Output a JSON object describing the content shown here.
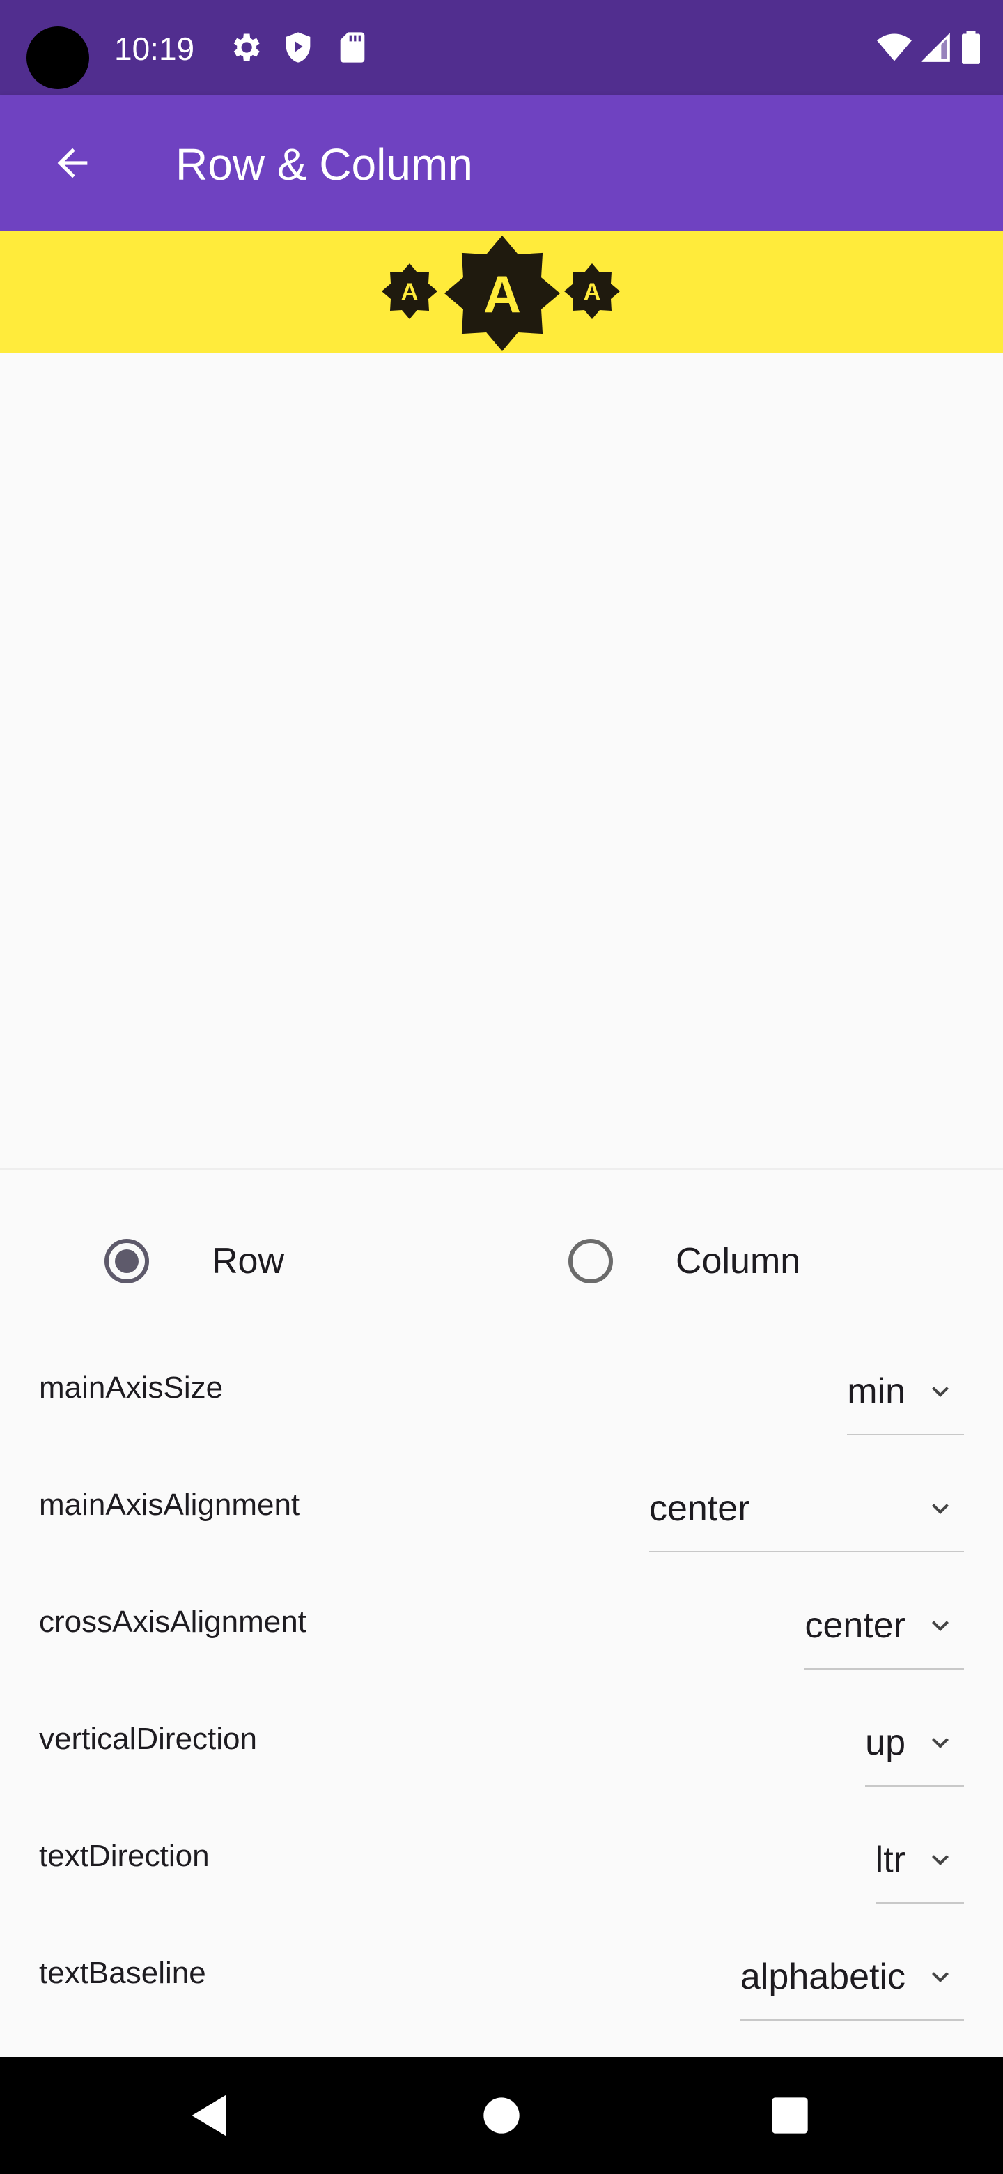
{
  "status_bar": {
    "time": "10:19",
    "icons_left": [
      "gear-icon",
      "shield-play-icon",
      "sd-card-icon"
    ],
    "icons_right": [
      "wifi-icon",
      "signal-icon",
      "battery-icon"
    ]
  },
  "app_bar": {
    "title": "Row & Column",
    "back_icon": "arrow-back-icon",
    "color": "#6f42c1"
  },
  "preview": {
    "background": "#ffeb3b",
    "items": [
      {
        "letter": "A",
        "size": "small"
      },
      {
        "letter": "A",
        "size": "large"
      },
      {
        "letter": "A",
        "size": "small"
      }
    ]
  },
  "layout_type": {
    "options": [
      {
        "label": "Row",
        "selected": true
      },
      {
        "label": "Column",
        "selected": false
      }
    ]
  },
  "settings": [
    {
      "label": "mainAxisSize",
      "value": "min"
    },
    {
      "label": "mainAxisAlignment",
      "value": "center"
    },
    {
      "label": "crossAxisAlignment",
      "value": "center"
    },
    {
      "label": "verticalDirection",
      "value": "up"
    },
    {
      "label": "textDirection",
      "value": "ltr"
    },
    {
      "label": "textBaseline",
      "value": "alphabetic"
    }
  ],
  "nav_bar": {
    "buttons": [
      "back-triangle-icon",
      "home-circle-icon",
      "recents-square-icon"
    ]
  }
}
